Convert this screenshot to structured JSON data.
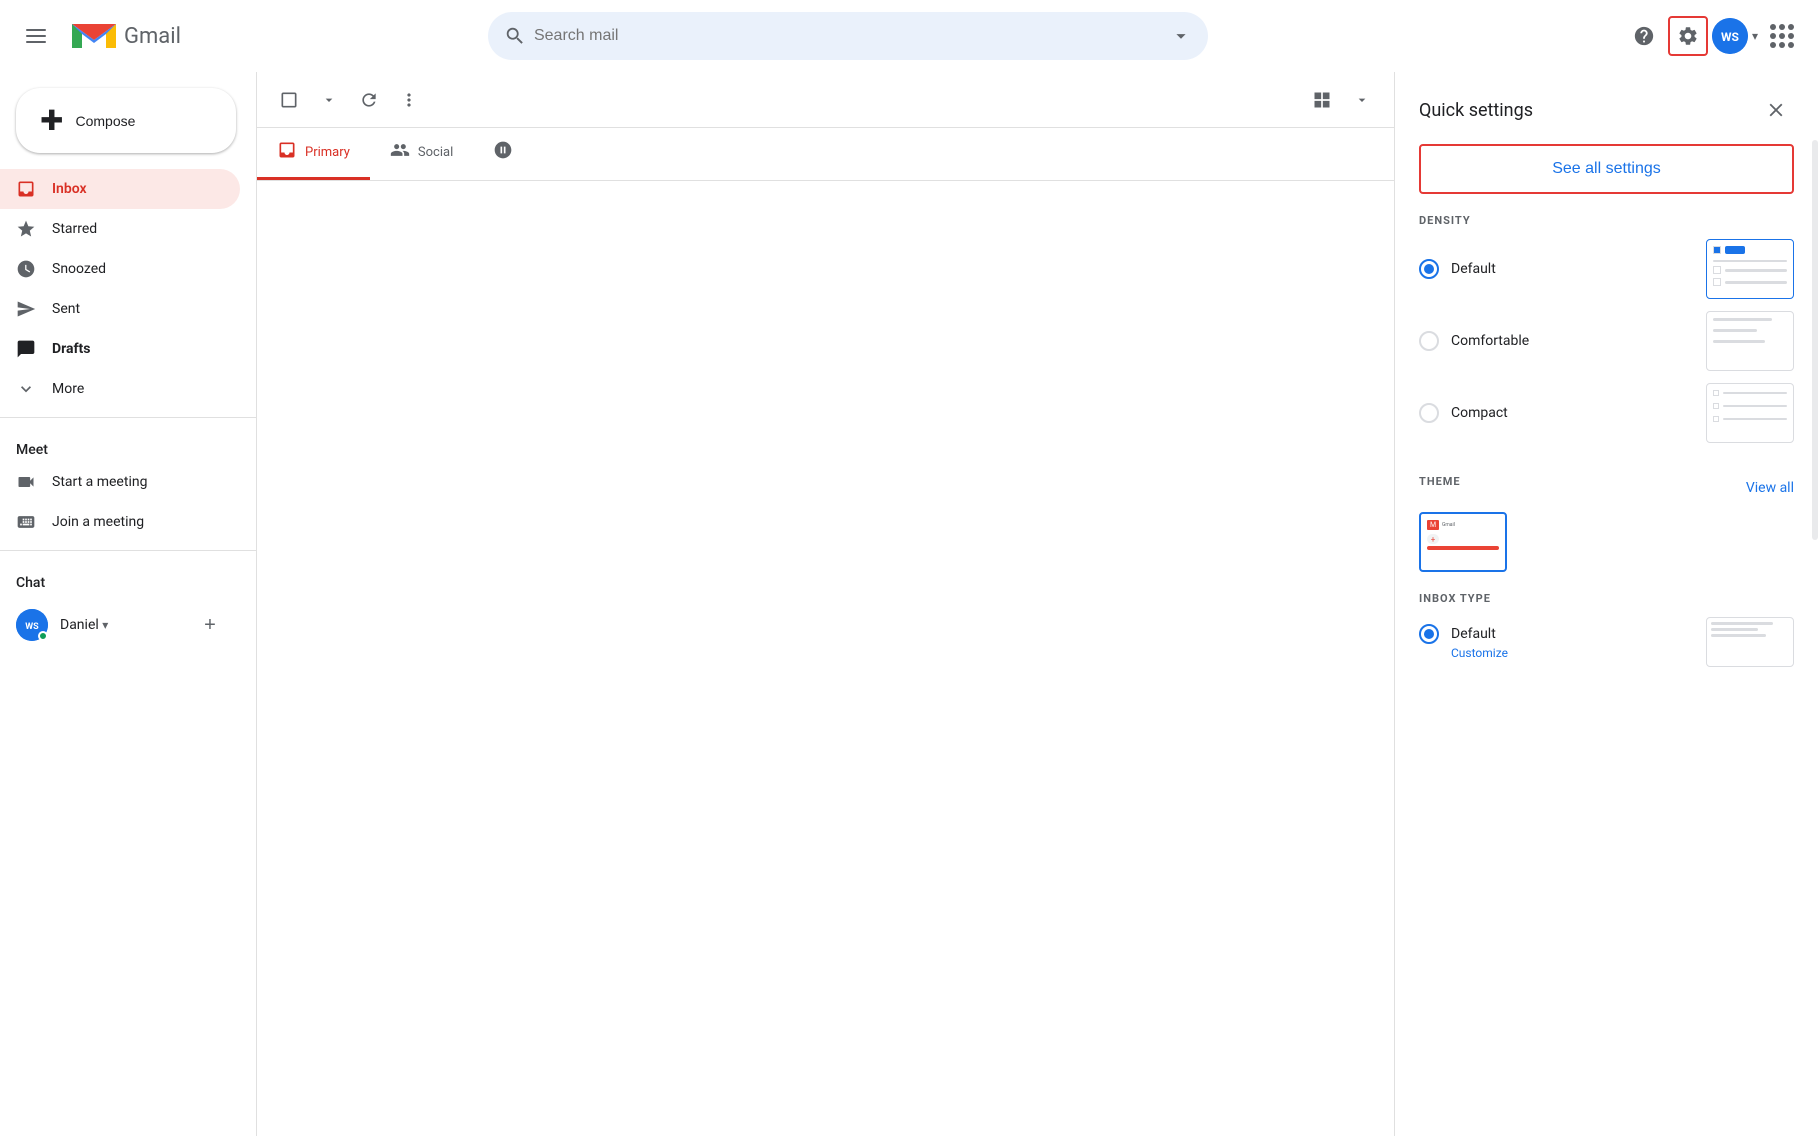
{
  "header": {
    "menu_label": "Main menu",
    "gmail_label": "Gmail",
    "search_placeholder": "Search mail",
    "help_label": "Help",
    "settings_label": "Settings",
    "apps_label": "Google apps",
    "account_label": "Google Account"
  },
  "sidebar": {
    "compose_label": "Compose",
    "nav_items": [
      {
        "id": "inbox",
        "label": "Inbox",
        "active": true
      },
      {
        "id": "starred",
        "label": "Starred",
        "active": false
      },
      {
        "id": "snoozed",
        "label": "Snoozed",
        "active": false
      },
      {
        "id": "sent",
        "label": "Sent",
        "active": false
      },
      {
        "id": "drafts",
        "label": "Drafts",
        "active": false
      },
      {
        "id": "more",
        "label": "More",
        "active": false
      }
    ],
    "meet_label": "Meet",
    "meet_items": [
      {
        "id": "start-meeting",
        "label": "Start a meeting"
      },
      {
        "id": "join-meeting",
        "label": "Join a meeting"
      }
    ],
    "chat_label": "Chat",
    "chat_user": {
      "name": "Daniel",
      "online": true
    },
    "add_chat_label": "+"
  },
  "toolbar": {
    "select_label": "Select",
    "refresh_label": "Refresh",
    "more_label": "More",
    "layout_label": "Choose layout"
  },
  "tabs": [
    {
      "id": "primary",
      "label": "Primary",
      "active": true
    },
    {
      "id": "social",
      "label": "Social",
      "active": false
    }
  ],
  "quick_settings": {
    "title": "Quick settings",
    "close_label": "Close",
    "see_all_label": "See all settings",
    "density": {
      "section_title": "DENSITY",
      "options": [
        {
          "id": "default",
          "label": "Default",
          "selected": true
        },
        {
          "id": "comfortable",
          "label": "Comfortable",
          "selected": false
        },
        {
          "id": "compact",
          "label": "Compact",
          "selected": false
        }
      ]
    },
    "theme": {
      "section_title": "THEME",
      "view_all_label": "View all"
    },
    "inbox_type": {
      "section_title": "INBOX TYPE",
      "options": [
        {
          "id": "default",
          "label": "Default",
          "sublabel": "Customize",
          "selected": true
        }
      ]
    }
  }
}
